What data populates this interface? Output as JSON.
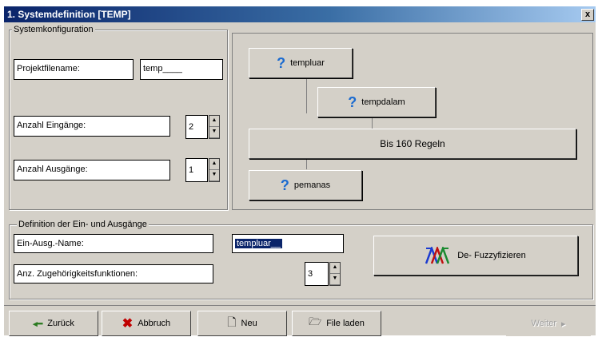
{
  "window": {
    "title": "1. Systemdefinition [TEMP]",
    "close_label": "x"
  },
  "config": {
    "group_label": "Systemkonfiguration",
    "project_label": "Projektfilename:",
    "project_value": "temp____",
    "inputs_label": "Anzahl Eingänge:",
    "inputs_value": "2",
    "outputs_label": "Anzahl Ausgänge:",
    "outputs_value": "1"
  },
  "diagram": {
    "input1": "templuar",
    "input2": "tempdalam",
    "rules": "Bis 160 Regeln",
    "output1": "pemanas"
  },
  "definition": {
    "group_label": "Definition der Ein- und Ausgänge",
    "name_label": "Ein-Ausg.-Name:",
    "name_value": "templuar__",
    "functions_label": "Anz. Zugehörigkeitsfunktionen:",
    "functions_value": "3",
    "defuzz_label": "De- Fuzzyfizieren"
  },
  "footer": {
    "back": "Zurück",
    "cancel": "Abbruch",
    "new": "Neu",
    "load": "File laden",
    "next": "Weiter"
  },
  "colors": {
    "title_start": "#0a246a",
    "title_end": "#a6caf0",
    "question": "#1a6ad0",
    "face": "#d4d0c8"
  }
}
